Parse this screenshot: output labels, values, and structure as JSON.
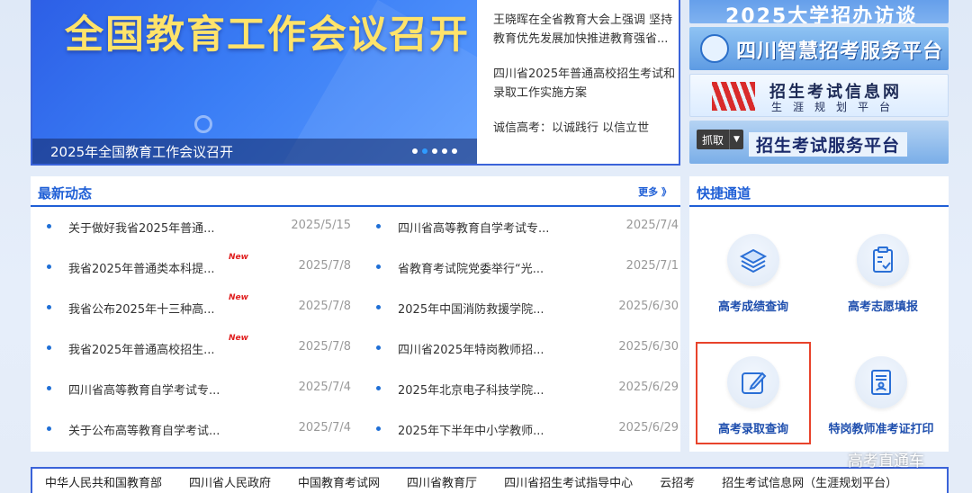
{
  "hero": {
    "title": "全国教育工作会议召开",
    "caption": "2025年全国教育工作会议召开",
    "slide_count": 5,
    "active_slide": 1
  },
  "headlines": [
    "王晓晖在全省教育大会上强调 坚持教育优先发展加快推进教育强省...",
    "四川省2025年普通高校招生考试和录取工作实施方案",
    "诚信高考：以诚践行 以信立世"
  ],
  "side_banners": {
    "b1": "2025大学招办访谈",
    "b2": "四川智慧招考服务平台",
    "b3_title": "招生考试信息网",
    "b3_sub": "生涯规划平台",
    "b4": "招生考试服务平台",
    "grab": "抓取"
  },
  "news": {
    "title": "最新动态",
    "more": "更多 》",
    "new_badge": "New",
    "left": [
      {
        "title": "关于做好我省2025年普通...",
        "date": "2025/5/15",
        "new": false
      },
      {
        "title": "我省2025年普通类本科提...",
        "date": "2025/7/8",
        "new": true
      },
      {
        "title": "我省公布2025年十三种高...",
        "date": "2025/7/8",
        "new": true
      },
      {
        "title": "我省2025年普通高校招生...",
        "date": "2025/7/8",
        "new": true
      },
      {
        "title": "四川省高等教育自学考试专...",
        "date": "2025/7/4",
        "new": false
      },
      {
        "title": "关于公布高等教育自学考试...",
        "date": "2025/7/4",
        "new": false
      }
    ],
    "right": [
      {
        "title": "四川省高等教育自学考试专...",
        "date": "2025/7/4"
      },
      {
        "title": "省教育考试院党委举行“光...",
        "date": "2025/7/1"
      },
      {
        "title": "2025年中国消防救援学院...",
        "date": "2025/6/30"
      },
      {
        "title": "四川省2025年特岗教师招...",
        "date": "2025/6/30"
      },
      {
        "title": "2025年北京电子科技学院...",
        "date": "2025/6/29"
      },
      {
        "title": "2025年下半年中小学教师...",
        "date": "2025/6/29"
      }
    ]
  },
  "quick": {
    "title": "快捷通道",
    "items": [
      {
        "label": "高考成绩查询",
        "icon": "layers-icon"
      },
      {
        "label": "高考志愿填报",
        "icon": "clipboard-check-icon"
      },
      {
        "label": "高考录取查询",
        "icon": "edit-icon"
      },
      {
        "label": "特岗教师准考证打印",
        "icon": "id-card-icon"
      }
    ]
  },
  "footer_links": [
    "中华人民共和国教育部",
    "四川省人民政府",
    "中国教育考试网",
    "四川省教育厅",
    "四川省招生考试指导中心",
    "云招考",
    "招生考试信息网（生涯规划平台）"
  ],
  "watermark": "高考直通车",
  "colors": {
    "accent": "#1f5fd6",
    "hero_title": "#ffe36a",
    "new_badge": "#e02020",
    "highlight_frame": "#e8432b"
  }
}
